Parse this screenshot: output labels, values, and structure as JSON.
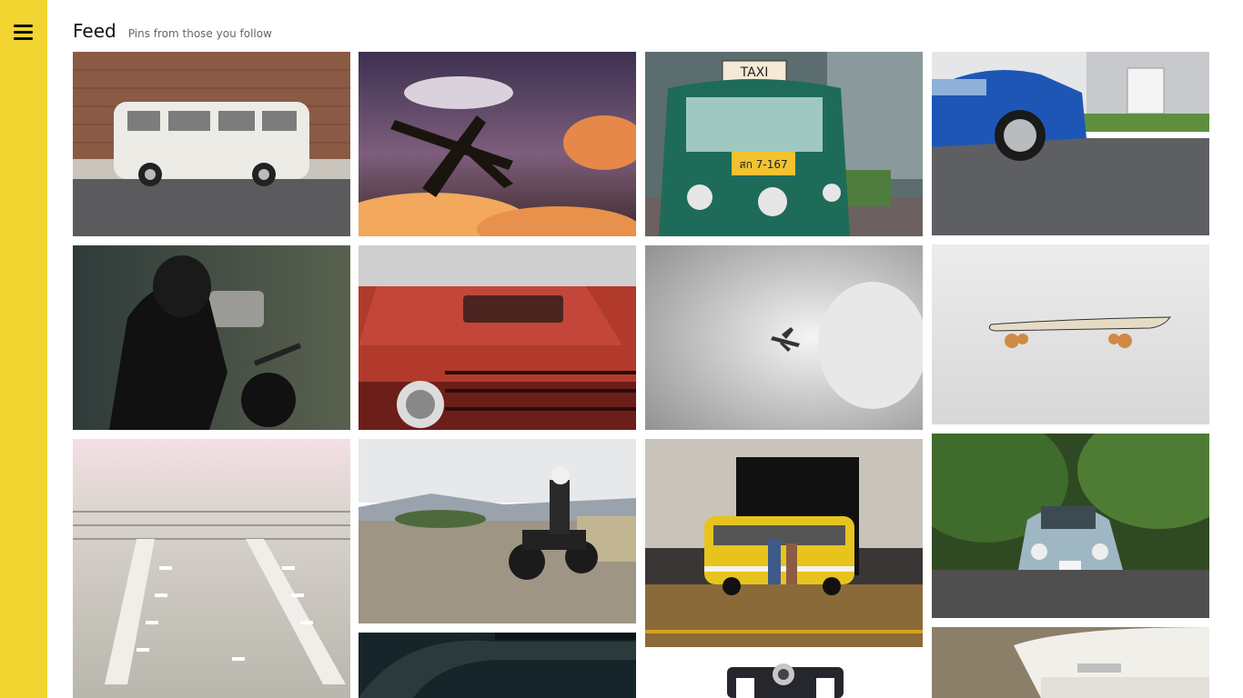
{
  "sidebar": {
    "menu_icon": "hamburger-menu-icon"
  },
  "header": {
    "title": "Feed",
    "subtitle": "Pins from those you follow"
  },
  "pins": [
    {
      "id": "van-brick-wall",
      "subject": "white vintage van by brick wall"
    },
    {
      "id": "plane-clouds",
      "subject": "propeller plane in orange clouds"
    },
    {
      "id": "tuk-tuk-taxi",
      "subject": "green tuk-tuk taxi"
    },
    {
      "id": "blue-sports-car",
      "subject": "blue sports car"
    },
    {
      "id": "motorcyclist-helmet",
      "subject": "rider in helmet with motorcycle"
    },
    {
      "id": "red-truck-hood",
      "subject": "red truck hood and headlight"
    },
    {
      "id": "plane-grey-sky",
      "subject": "airplane in grey sky"
    },
    {
      "id": "skateboard",
      "subject": "skateboard on white floor"
    },
    {
      "id": "airport-aerial",
      "subject": "aerial view of airport"
    },
    {
      "id": "motorcycle-field",
      "subject": "rider on motorcycle in field"
    },
    {
      "id": "yellow-van-night",
      "subject": "yellow van at night"
    },
    {
      "id": "blue-beetle-trees",
      "subject": "blue beetle under trees"
    },
    {
      "id": "dark-car-interior",
      "subject": "dark car detail"
    },
    {
      "id": "camera-white",
      "subject": "camera on white background"
    },
    {
      "id": "white-car-badge",
      "subject": "white car rear badge"
    }
  ],
  "visible_text": {
    "taxi_sign": "TAXI",
    "tuk_plate": "สก 7-167"
  }
}
